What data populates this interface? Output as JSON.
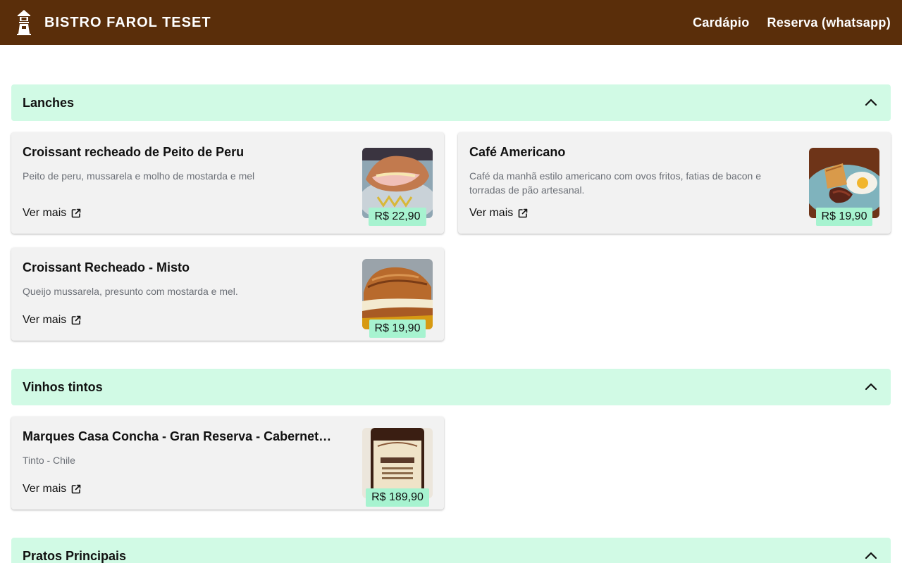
{
  "header": {
    "brand": "BISTRO FAROL TESET",
    "nav": [
      "Cardápio",
      "Reserva (whatsapp)"
    ]
  },
  "colors": {
    "header_bg": "#5a2e0a",
    "section_bg": "#d1fae5",
    "price_bg": "#a7f3d0",
    "card_bg": "#f2f2f2"
  },
  "icons": {
    "brand": "lighthouse-icon",
    "collapse": "chevron-up-icon",
    "external": "external-link-icon"
  },
  "sections": [
    {
      "title": "Lanches",
      "items": [
        {
          "title": "Croissant recheado de Peito de Peru",
          "description": "Peito de peru, mussarela e molho de mostarda e mel",
          "link": "Ver mais",
          "price": "R$ 22,90"
        },
        {
          "title": "Café Americano",
          "description": "Café da manhã estilo americano com ovos fritos, fatias de bacon e torradas de pão artesanal.",
          "link": "Ver mais",
          "price": "R$ 19,90"
        },
        {
          "title": "Croissant Recheado - Misto",
          "description": "Queijo mussarela, presunto com mostarda e mel.",
          "link": "Ver mais",
          "price": "R$ 19,90"
        }
      ]
    },
    {
      "title": "Vinhos tintos",
      "items": [
        {
          "title": "Marques Casa Concha - Gran Reserva - Cabernet Sauvignon",
          "description": "Tinto - Chile",
          "link": "Ver mais",
          "price": "R$ 189,90"
        }
      ]
    },
    {
      "title": "Pratos Principais",
      "items": []
    }
  ]
}
